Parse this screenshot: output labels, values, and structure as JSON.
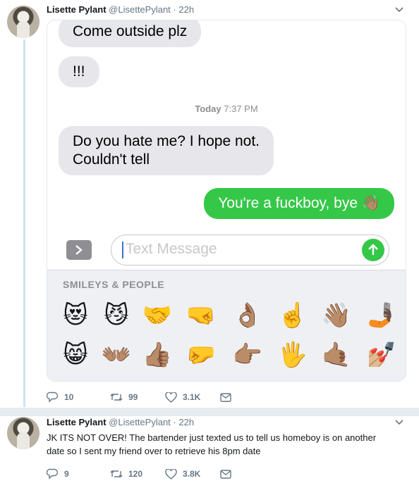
{
  "tweet1": {
    "name": "Lisette Pylant",
    "handle": "@LisettePylant",
    "time": "· 22h",
    "screenshot": {
      "messages": [
        {
          "side": "received",
          "text": "Come outside plz"
        },
        {
          "side": "received",
          "text": "!!!"
        },
        {
          "side": "received",
          "text": "Do you hate me? I hope not."
        },
        {
          "side": "received",
          "text": "Couldn't tell"
        },
        {
          "side": "sent",
          "text": "You're a fuckboy, bye 👋🏽"
        }
      ],
      "timestamp_day": "Today",
      "timestamp_time": "7:37 PM",
      "input_placeholder": "Text Message",
      "keyboard_section": "SMILEYS & PEOPLE",
      "emoji_row1": [
        "😻",
        "😼",
        "🤝",
        "🤜",
        "👌🏽",
        "☝️",
        "👋🏽",
        "🤳🏿"
      ],
      "emoji_row2": [
        "😸",
        "👐🏽",
        "👍🏽",
        "🤛",
        "👉🏽",
        "🖐",
        "🤙🏽",
        "💅🏼"
      ],
      "accent_sent": "#35c748",
      "bubble_received": "#e6e6eb"
    },
    "stats": {
      "replies": "10",
      "retweets": "99",
      "likes": "3.1K"
    }
  },
  "tweet2": {
    "name": "Lisette Pylant",
    "handle": "@LisettePylant",
    "time": "· 22h",
    "text_line1": "JK ITS NOT OVER! The bartender just texted us to tell us homeboy is on another",
    "text_line2": "date so I sent my friend over to retrieve his 8pm date",
    "stats": {
      "replies": "9",
      "retweets": "120",
      "likes": "3.8K"
    }
  },
  "icons": {
    "reply": "reply-icon",
    "retweet": "retweet-icon",
    "like": "heart-icon",
    "dm": "envelope-icon",
    "caret": "chevron-down-icon"
  }
}
